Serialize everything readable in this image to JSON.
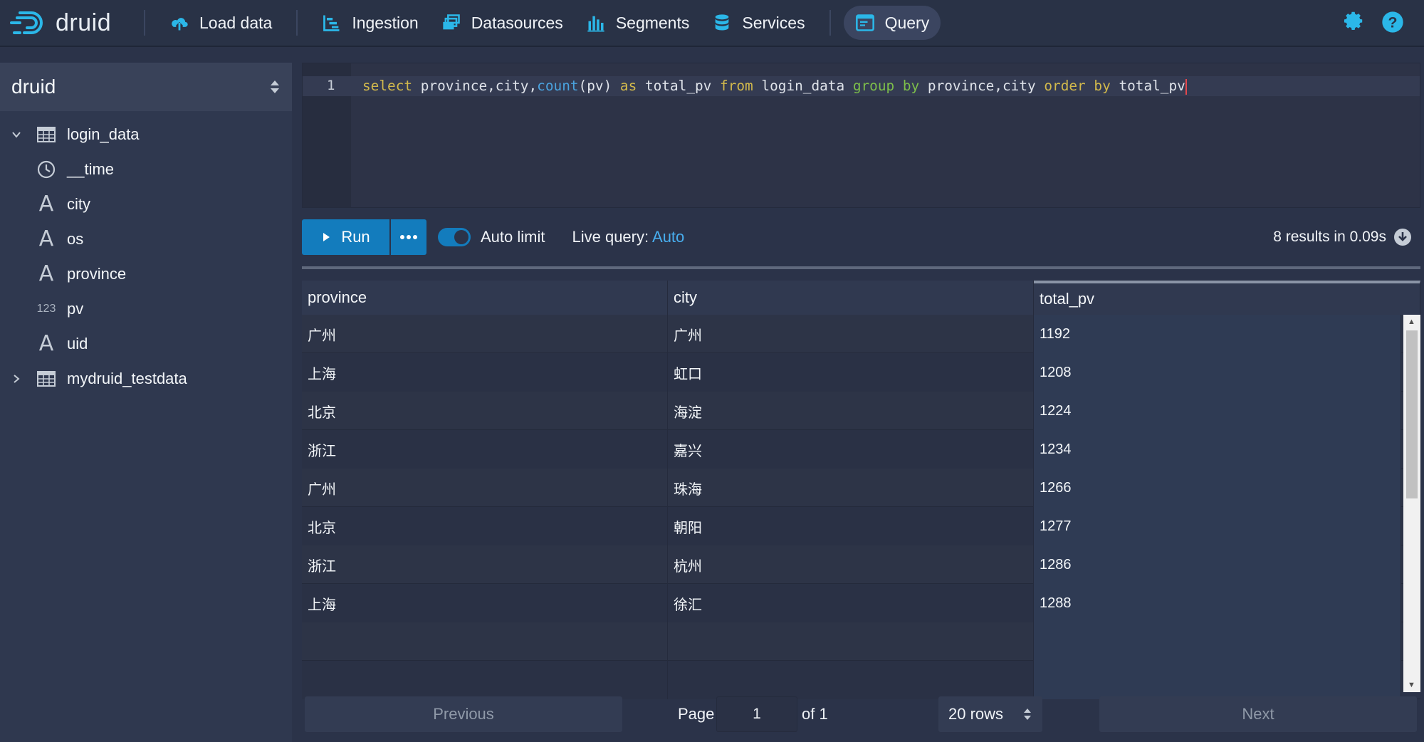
{
  "app": {
    "logo_text": "druid"
  },
  "nav": {
    "items": [
      {
        "label": "Load data",
        "icon": "cloud-upload-icon"
      },
      {
        "label": "Ingestion",
        "icon": "gantt-chart-icon"
      },
      {
        "label": "Datasources",
        "icon": "multi-select-icon"
      },
      {
        "label": "Segments",
        "icon": "stacked-chart-icon"
      },
      {
        "label": "Services",
        "icon": "database-icon"
      },
      {
        "label": "Query",
        "icon": "application-icon",
        "active": true
      }
    ],
    "right_icons": [
      "gear-icon",
      "help-icon"
    ]
  },
  "sidebar": {
    "datasource_select": "druid",
    "tree": [
      {
        "label": "login_data",
        "type": "table",
        "expanded": true
      },
      {
        "label": "__time",
        "type": "time"
      },
      {
        "label": "city",
        "type": "string"
      },
      {
        "label": "os",
        "type": "string"
      },
      {
        "label": "province",
        "type": "string"
      },
      {
        "label": "pv",
        "type": "number",
        "type_label": "123"
      },
      {
        "label": "uid",
        "type": "string"
      },
      {
        "label": "mydruid_testdata",
        "type": "table",
        "expanded": false
      }
    ]
  },
  "editor": {
    "line_number": "1",
    "tokens": [
      "select",
      " province,city,",
      "count",
      "(pv) ",
      "as",
      " total_pv ",
      "from",
      " login_data ",
      "group by",
      " province,city ",
      "order by",
      " total_pv"
    ]
  },
  "controls": {
    "run_label": "Run",
    "auto_limit_label": "Auto limit",
    "auto_limit_on": true,
    "live_query_label": "Live query:",
    "live_query_value": "Auto",
    "results_info": "8 results in 0.09s"
  },
  "table": {
    "columns": [
      "province",
      "city",
      "total_pv"
    ],
    "rows": [
      [
        "广州",
        "广州",
        "1192"
      ],
      [
        "上海",
        "虹口",
        "1208"
      ],
      [
        "北京",
        "海淀",
        "1224"
      ],
      [
        "浙江",
        "嘉兴",
        "1234"
      ],
      [
        "广州",
        "珠海",
        "1266"
      ],
      [
        "北京",
        "朝阳",
        "1277"
      ],
      [
        "浙江",
        "杭州",
        "1286"
      ],
      [
        "上海",
        "徐汇",
        "1288"
      ]
    ]
  },
  "pager": {
    "previous_label": "Previous",
    "page_label": "Page",
    "page_value": "1",
    "of_label": "of 1",
    "rows_select": "20 rows",
    "next_label": "Next"
  },
  "colors": {
    "accent": "#137cbd",
    "live_auto": "#48aff0",
    "background": "#2b3349"
  }
}
